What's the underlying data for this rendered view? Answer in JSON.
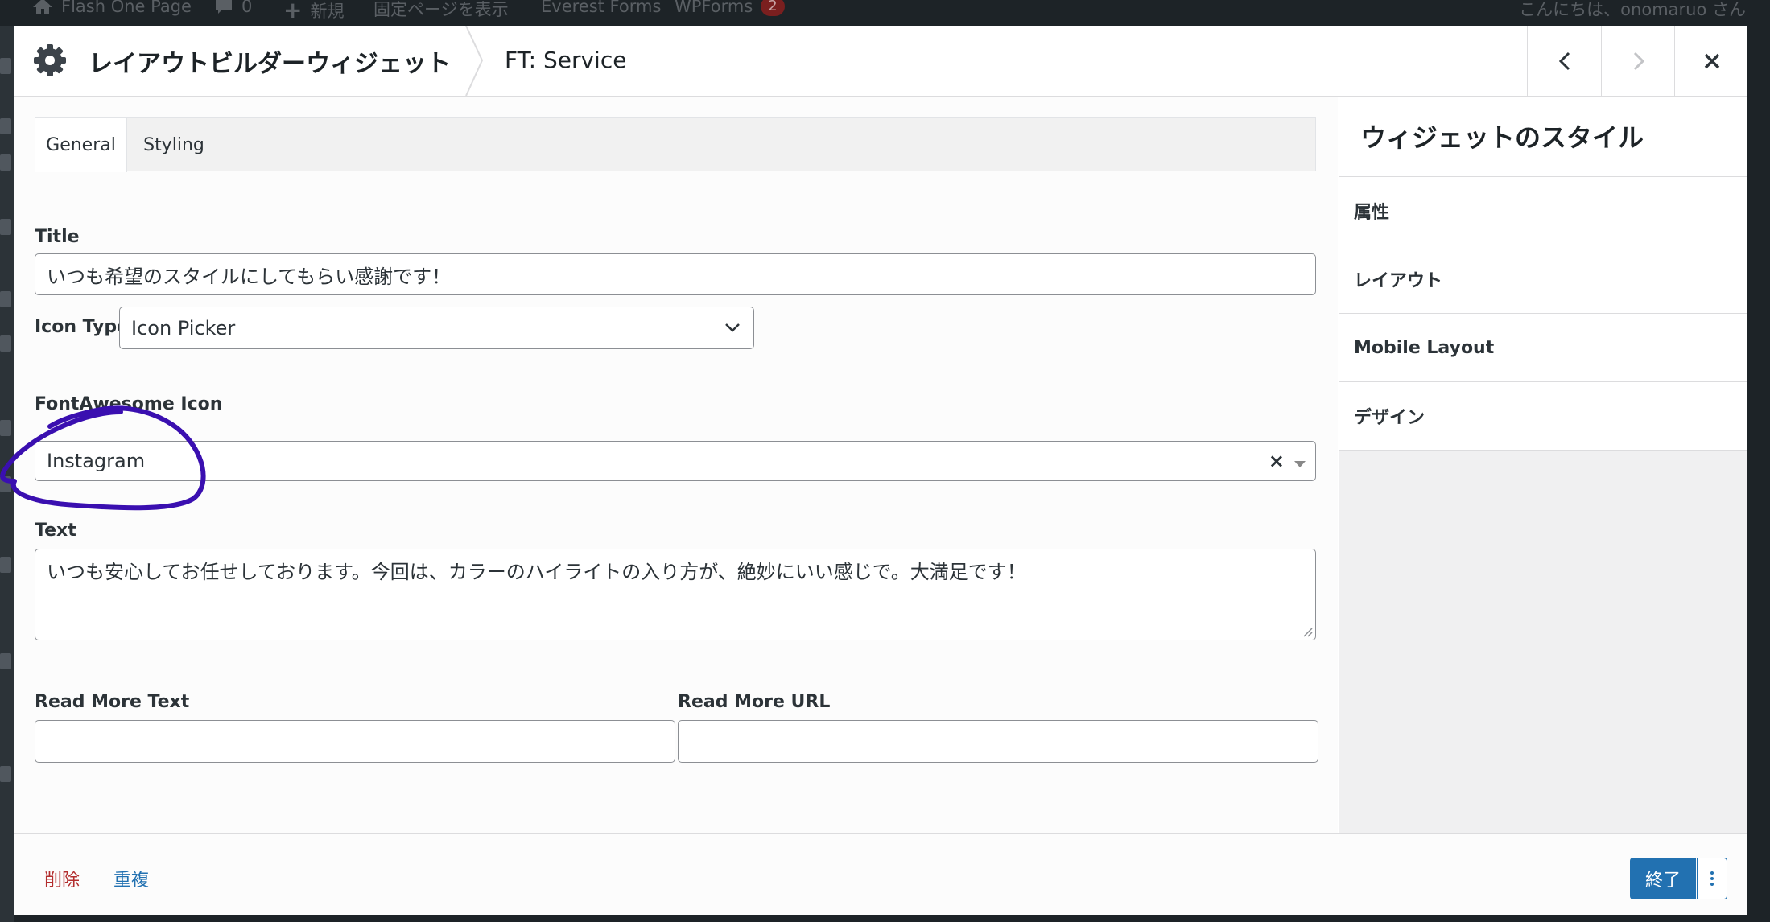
{
  "admin_bar": {
    "site_name": "Flash One Page",
    "comments_count": "0",
    "new_label": "新規",
    "view_page_label": "固定ページを表示",
    "everest_forms_label": "Everest Forms",
    "wpforms_label": "WPForms",
    "wpforms_badge": "2",
    "greeting": "こんにちは、onomaruo さん"
  },
  "modal": {
    "title": "レイアウトビルダーウィジェット",
    "widget_name": "FT: Service",
    "prev_icon": "chevron-left-icon",
    "next_icon": "chevron-right-icon",
    "close_icon": "close-icon"
  },
  "tabs": [
    {
      "label": "General",
      "active": true
    },
    {
      "label": "Styling",
      "active": false
    }
  ],
  "form": {
    "title_label": "Title",
    "title_value": "いつも希望のスタイルにしてもらい感謝です！",
    "icon_type_label": "Icon Type",
    "icon_type_value": "Icon Picker",
    "fa_icon_label": "FontAwesome Icon",
    "fa_icon_value": "Instagram",
    "clear_glyph": "×",
    "text_label": "Text",
    "text_value": "いつも安心してお任せしております。今回は、カラーのハイライトの入り方が、絶妙にいい感じで。大満足です！",
    "read_more_text_label": "Read More Text",
    "read_more_text_value": "",
    "read_more_url_label": "Read More URL",
    "read_more_url_value": ""
  },
  "sidebar": {
    "title": "ウィジェットのスタイル",
    "items": [
      {
        "label": "属性"
      },
      {
        "label": "レイアウト"
      },
      {
        "label": "Mobile Layout"
      },
      {
        "label": "デザイン"
      }
    ]
  },
  "footer": {
    "delete_label": "削除",
    "duplicate_label": "重複",
    "done_label": "終了"
  },
  "colors": {
    "accent": "#2271b1",
    "delete": "#b32d2e",
    "annotation": "#3a0fb0"
  }
}
